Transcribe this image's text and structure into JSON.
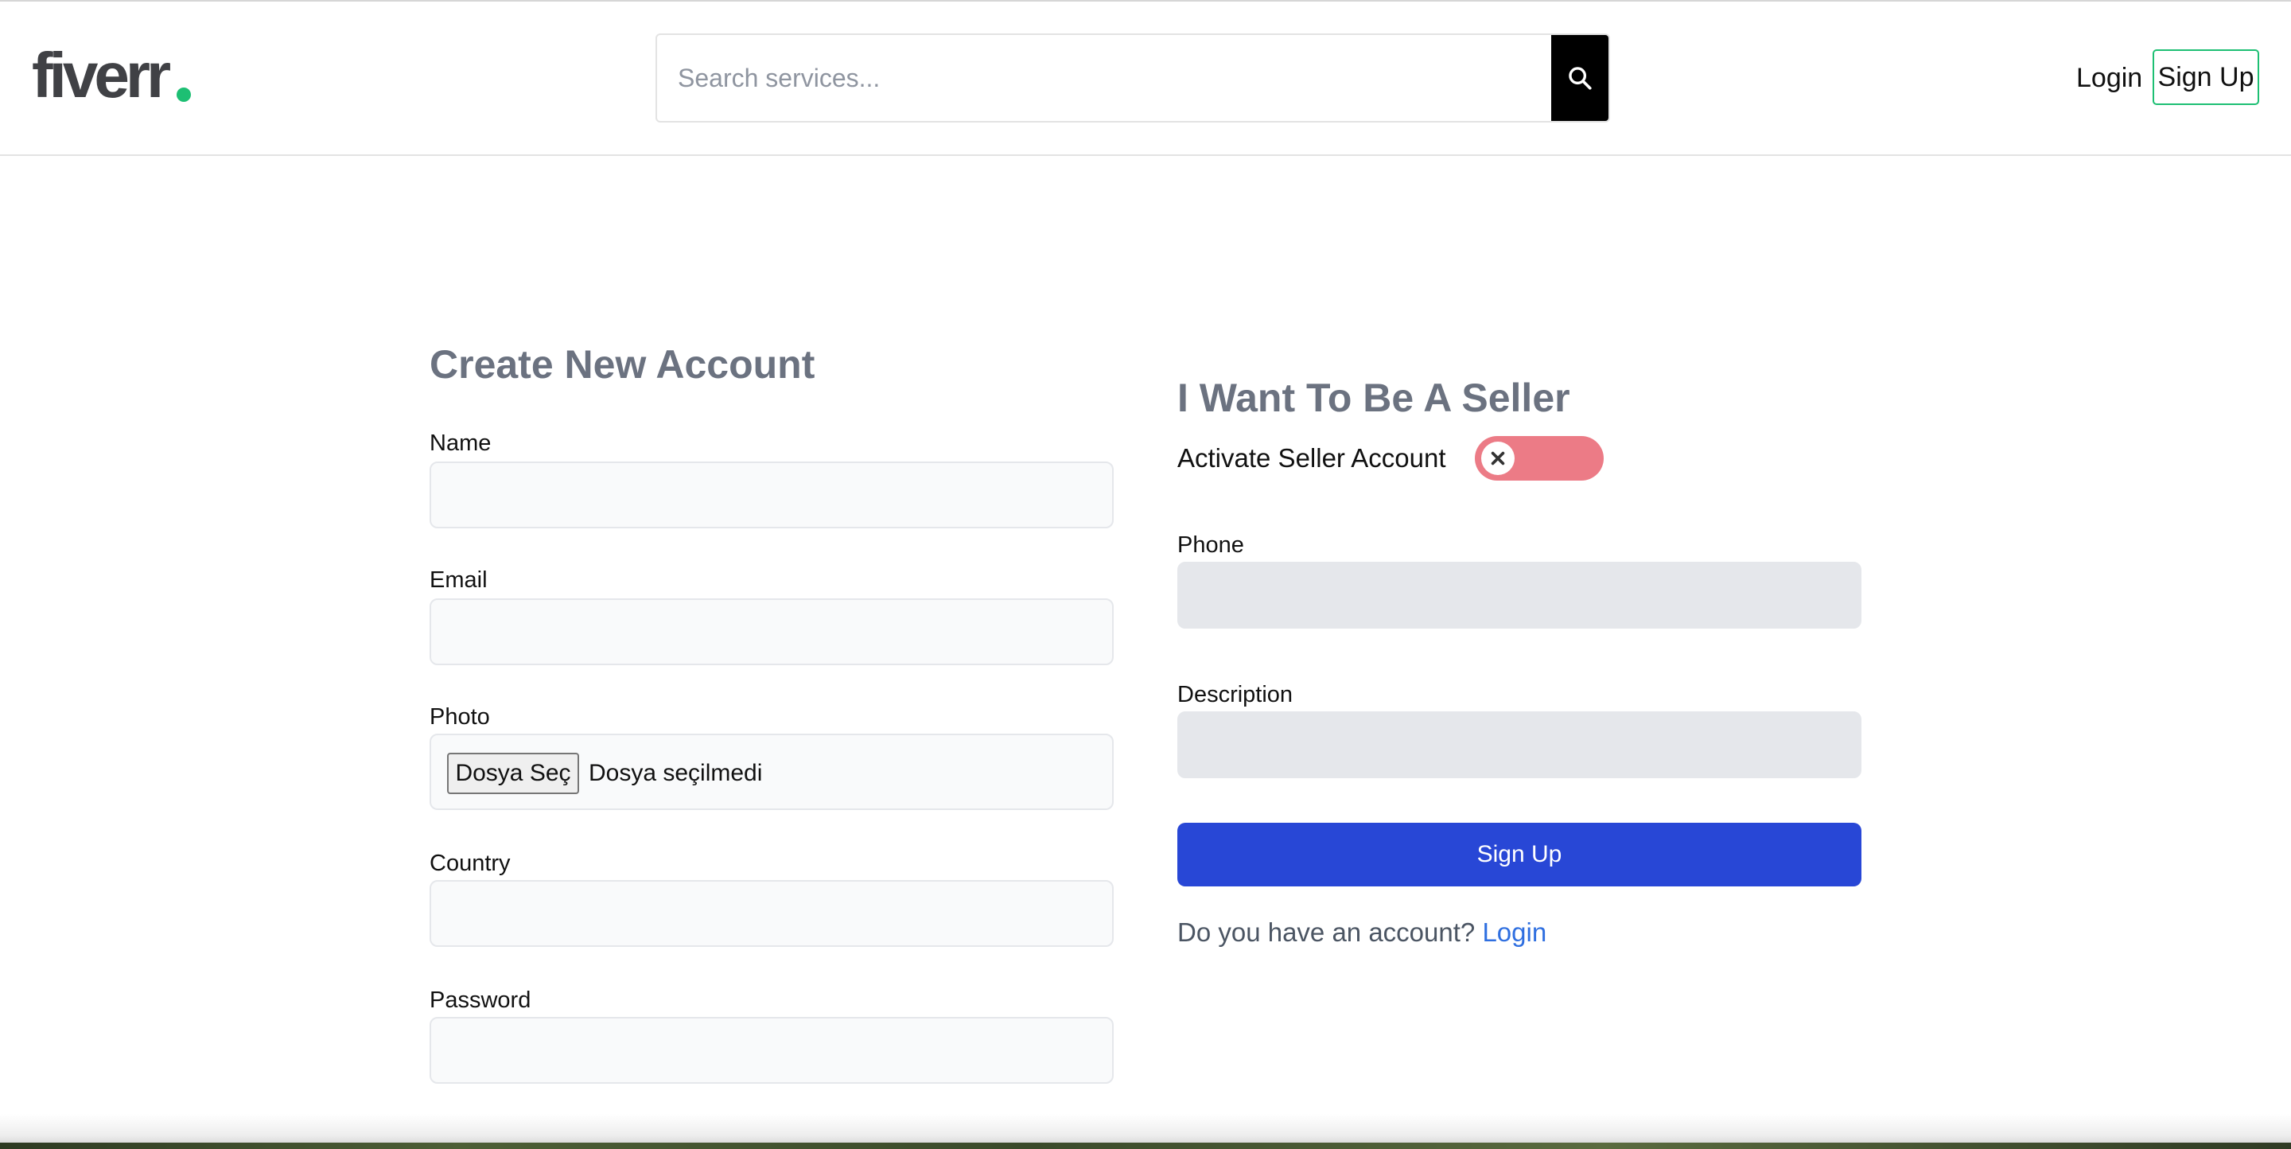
{
  "header": {
    "logo_text": "fiverr",
    "search": {
      "placeholder": "Search services...",
      "value": ""
    },
    "nav": {
      "login_label": "Login",
      "signup_label": "Sign Up"
    }
  },
  "account_form": {
    "title": "Create New Account",
    "fields": {
      "name": {
        "label": "Name",
        "value": ""
      },
      "email": {
        "label": "Email",
        "value": ""
      },
      "photo": {
        "label": "Photo",
        "button_label": "Dosya Seç",
        "status_text": "Dosya seçilmedi"
      },
      "country": {
        "label": "Country",
        "value": ""
      },
      "password": {
        "label": "Password",
        "value": ""
      }
    }
  },
  "seller_form": {
    "title": "I Want To Be A Seller",
    "toggle_label": "Activate Seller Account",
    "toggle_on": false,
    "fields": {
      "phone": {
        "label": "Phone",
        "value": ""
      },
      "description": {
        "label": "Description",
        "value": ""
      }
    },
    "submit_label": "Sign Up",
    "account_prompt": "Do you have an account?",
    "login_link": "Login"
  },
  "colors": {
    "brand_green": "#1dbf73",
    "primary_button": "#2847d6",
    "link": "#2f6fe0",
    "toggle_off": "#ec7b86",
    "title_gray": "#6b7280"
  },
  "icons": [
    "search-icon",
    "close-icon"
  ]
}
